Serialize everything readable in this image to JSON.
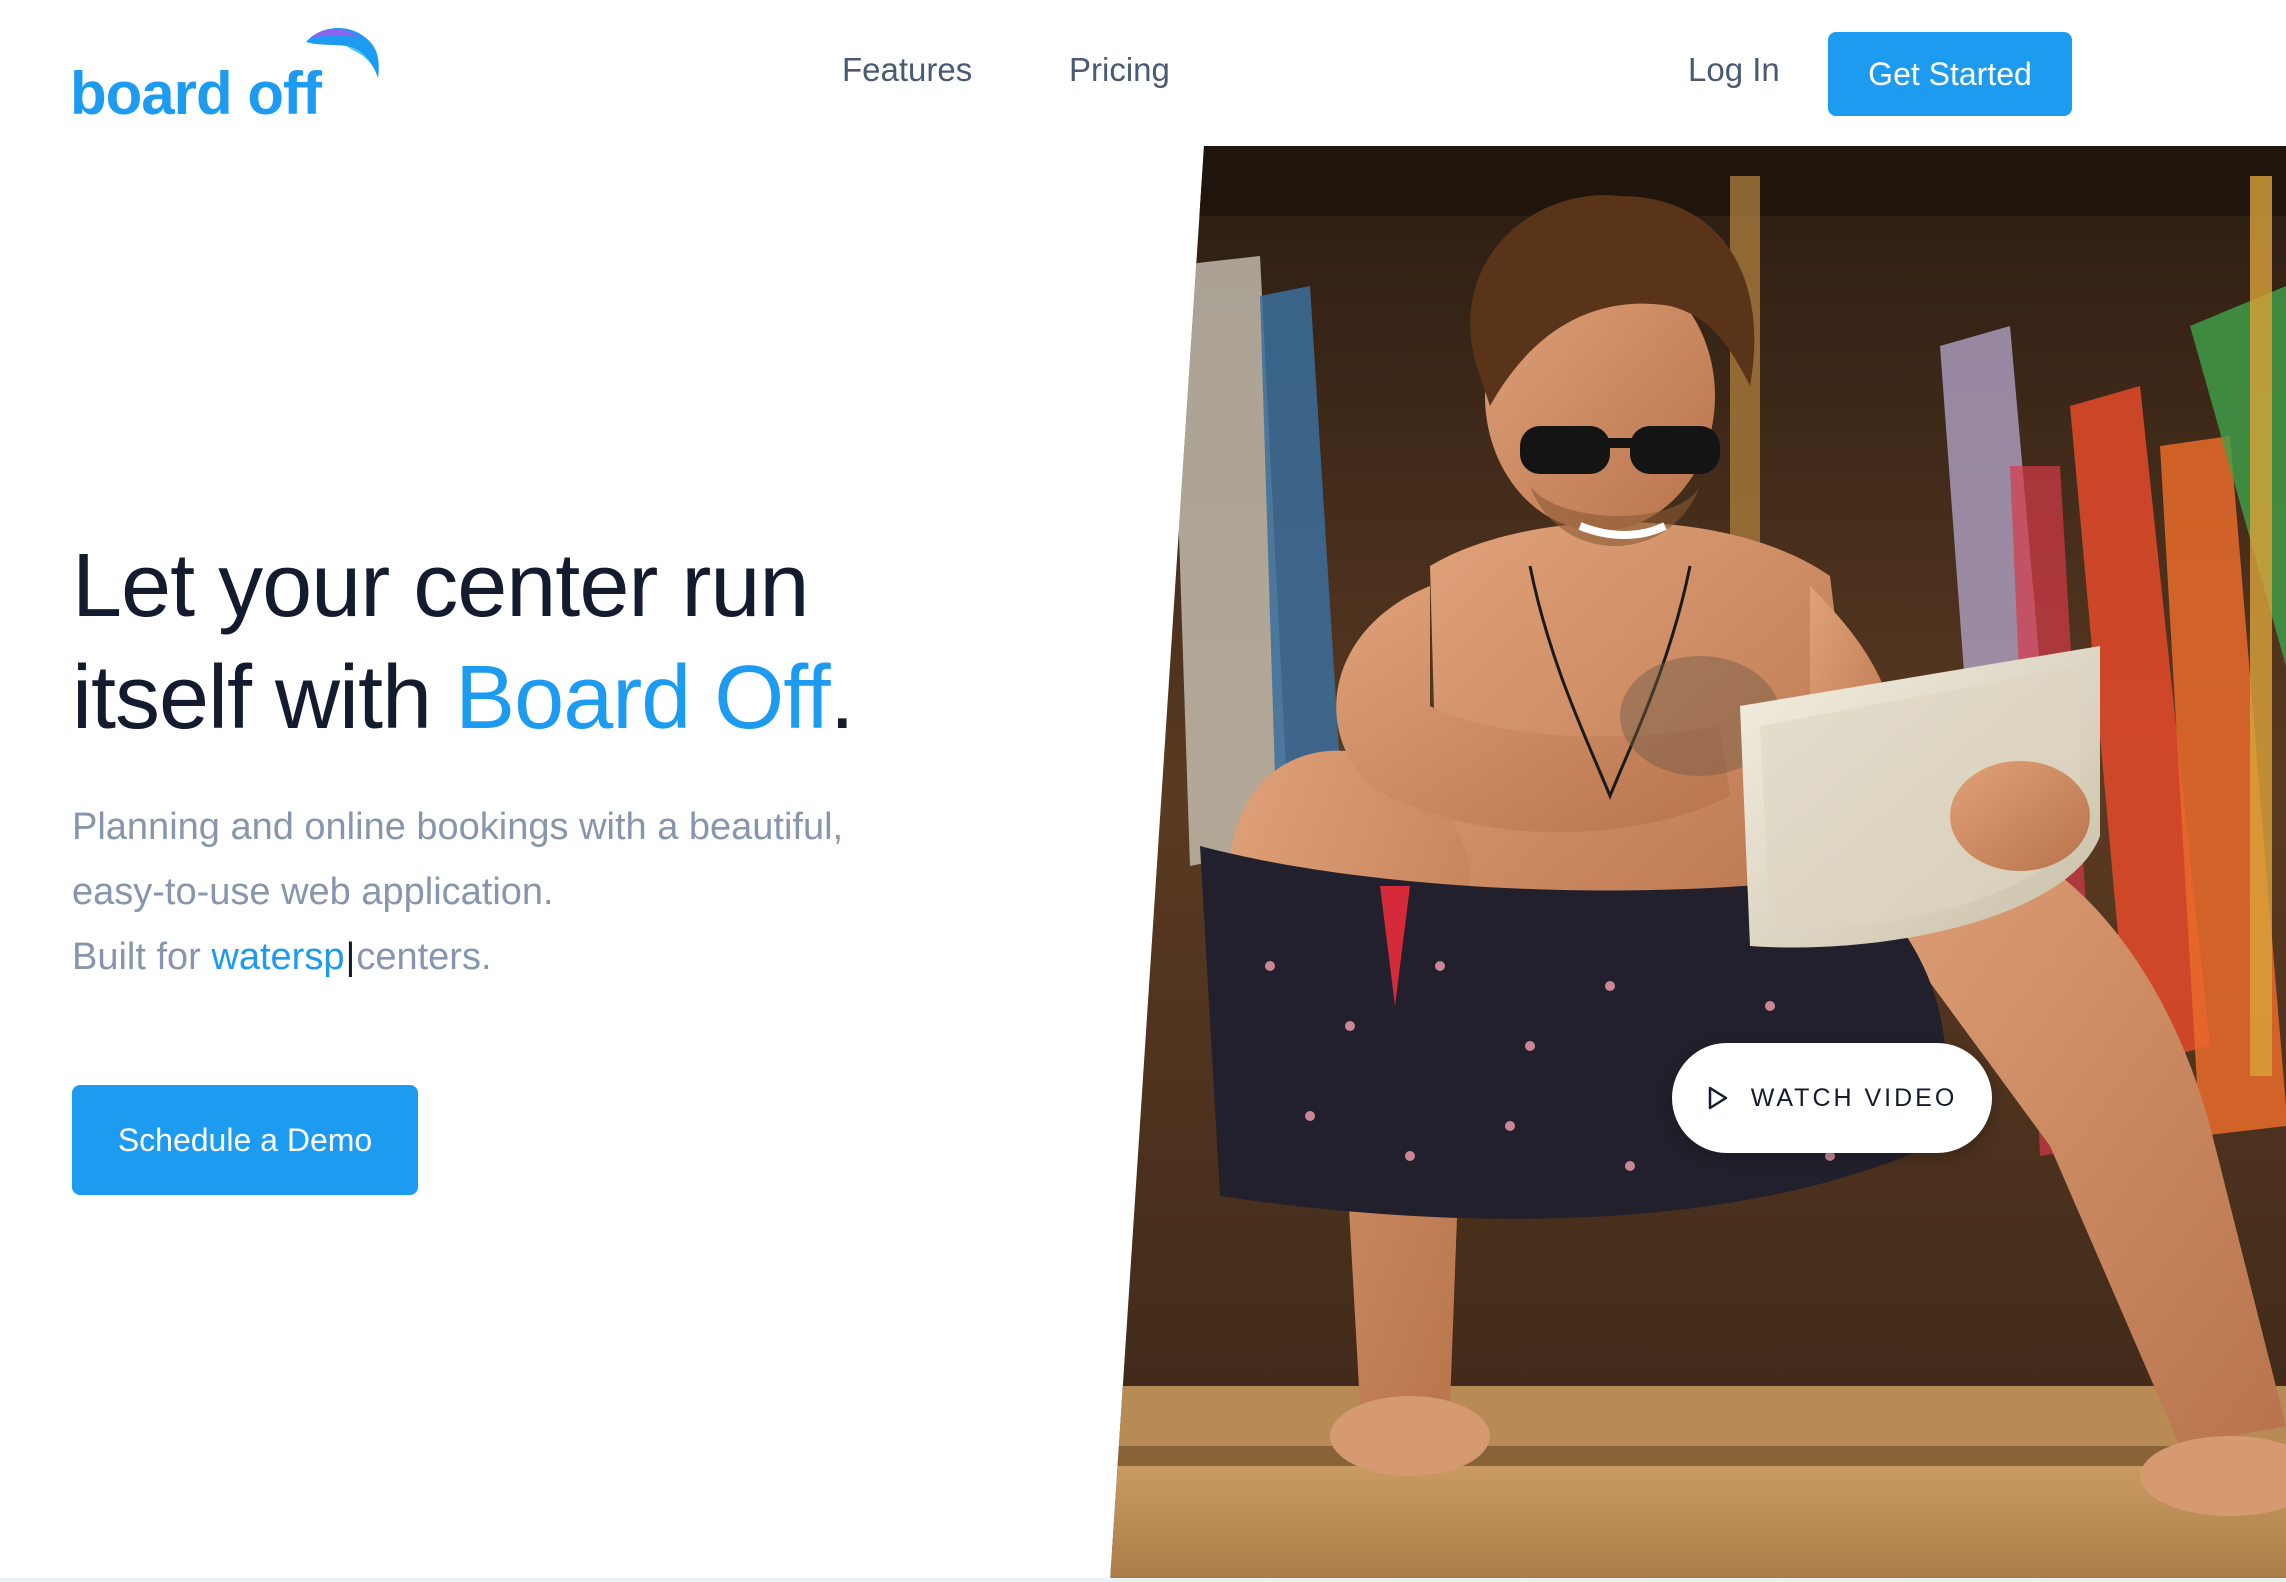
{
  "header": {
    "logo_text": "board off",
    "nav": {
      "features": "Features",
      "pricing": "Pricing",
      "login": "Log In",
      "get_started": "Get Started"
    }
  },
  "hero": {
    "headline_part1": "Let your center run itself with ",
    "headline_brand": "Board Off",
    "headline_end": ".",
    "sub_line1": "Planning and online bookings with a beautiful,",
    "sub_line2": "easy-to-use web application.",
    "sub_built_prefix": "Built for ",
    "sub_typed": "watersp",
    "sub_caret": "|",
    "sub_built_suffix": "centers.",
    "cta_demo": "Schedule a Demo",
    "watch_video": "WATCH VIDEO"
  },
  "colors": {
    "brand_blue": "#1d9bf0",
    "heading": "#141b2e",
    "muted": "#8796ad",
    "nav": "#4a5a73"
  },
  "icons": {
    "logo_mark": "wave-icon",
    "watch_video": "play-icon"
  }
}
